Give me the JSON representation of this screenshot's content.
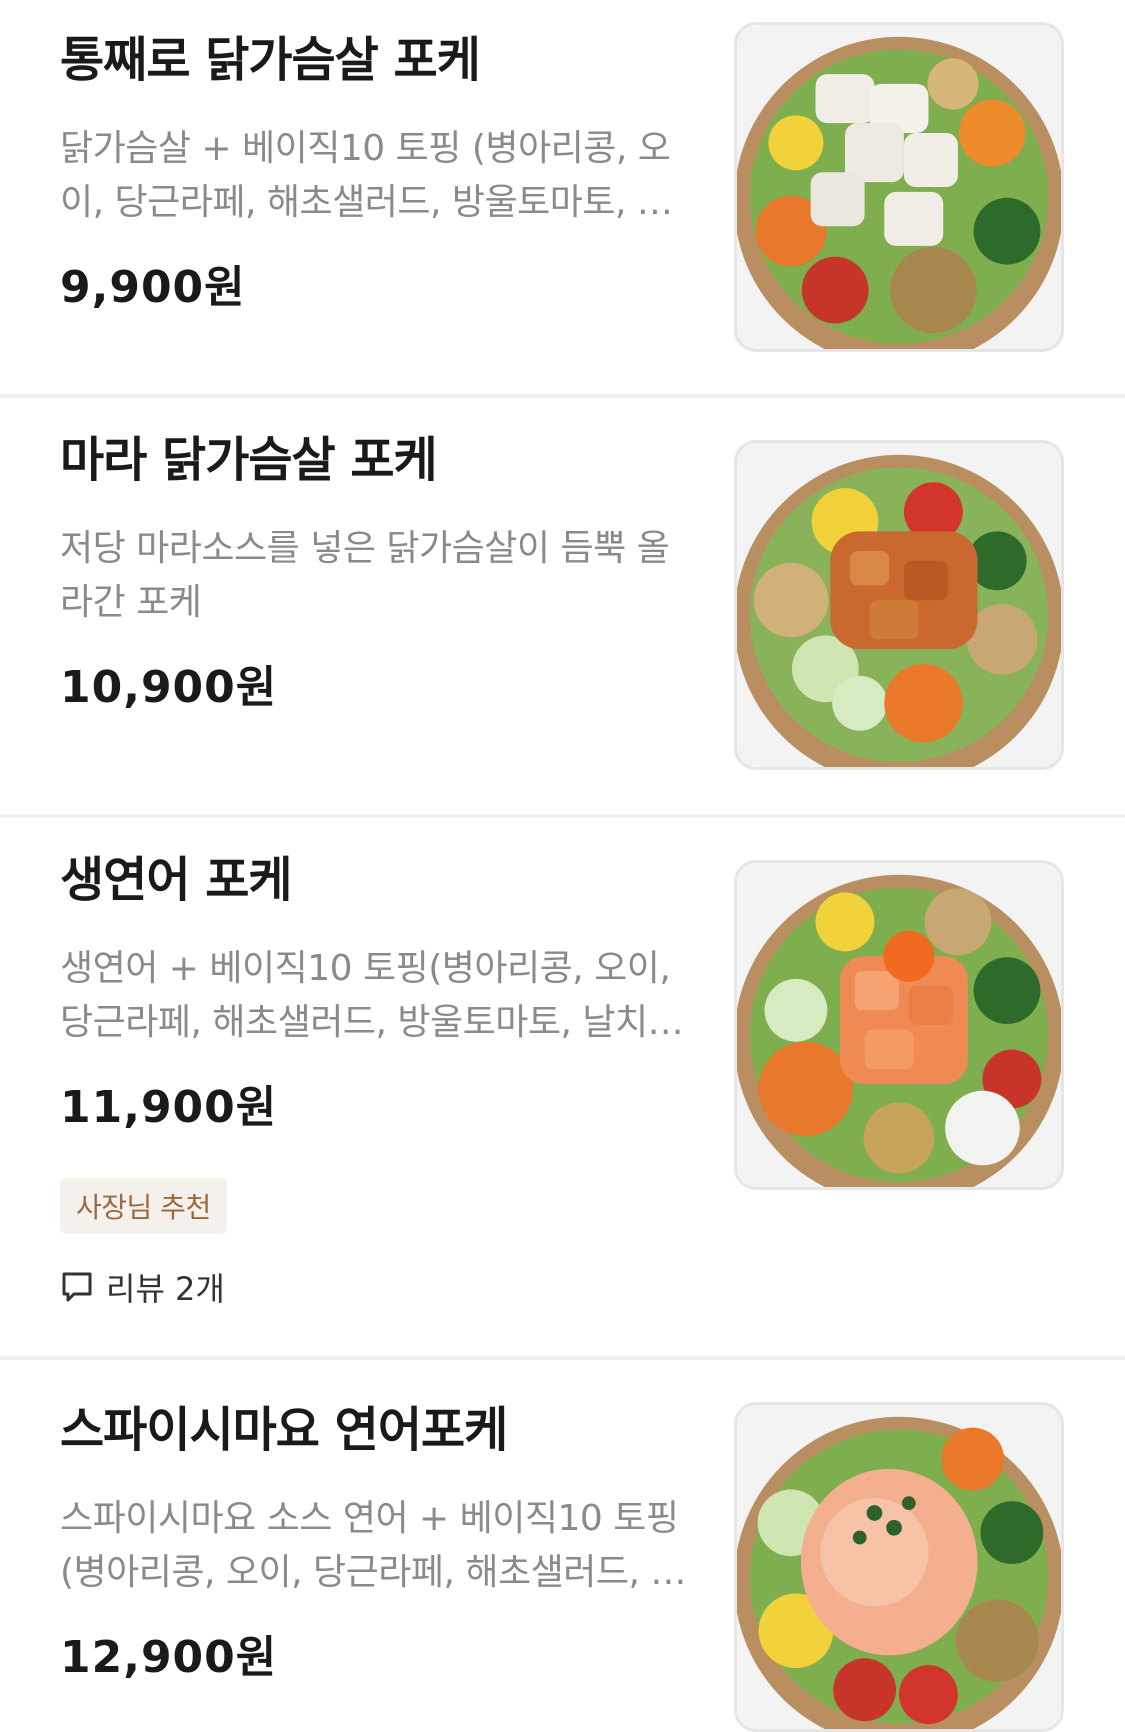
{
  "menu_items": [
    {
      "name": "통째로 닭가슴살 포케",
      "description": "닭가슴살 + 베이직10 토핑 (병아리콩, 오이, 당근라페, 해초샐러드, 방울토마토, 날치알, 옥수수, 양배추, 크리스피 어니언, 양파)",
      "price": "9,900원",
      "image_alt": "chicken-breast-poke-bowl-photo"
    },
    {
      "name": "마라 닭가슴살 포케",
      "description": "저당 마라소스를 넣은 닭가슴살이 듬뿍 올라간 포케",
      "price": "10,900원",
      "image_alt": "mala-chicken-poke-bowl-photo"
    },
    {
      "name": "생연어 포케",
      "description": "생연어 + 베이직10 토핑(병아리콩, 오이, 당근라페, 해초샐러드, 방울토마토, 날치알, 옥수수, 양배추, 크리스피 어니언, 양파)",
      "price": "11,900원",
      "badge": "사장님 추천",
      "review": "리뷰 2개",
      "image_alt": "salmon-poke-bowl-photo"
    },
    {
      "name": "스파이시마요 연어포케",
      "description": "스파이시마요 소스 연어 + 베이직10 토핑(병아리콩, 오이, 당근라페, 해초샐러드, 방울토마토, 날치알, 옥수수)",
      "price": "12,900원",
      "image_alt": "spicy-mayo-salmon-poke-bowl-photo"
    }
  ],
  "colors": {
    "price": "#1a1a1a",
    "description": "#8a8a8a",
    "badge_bg": "#f4f0ec",
    "badge_text": "#9a6a3d",
    "divider": "#f1f1f1"
  }
}
